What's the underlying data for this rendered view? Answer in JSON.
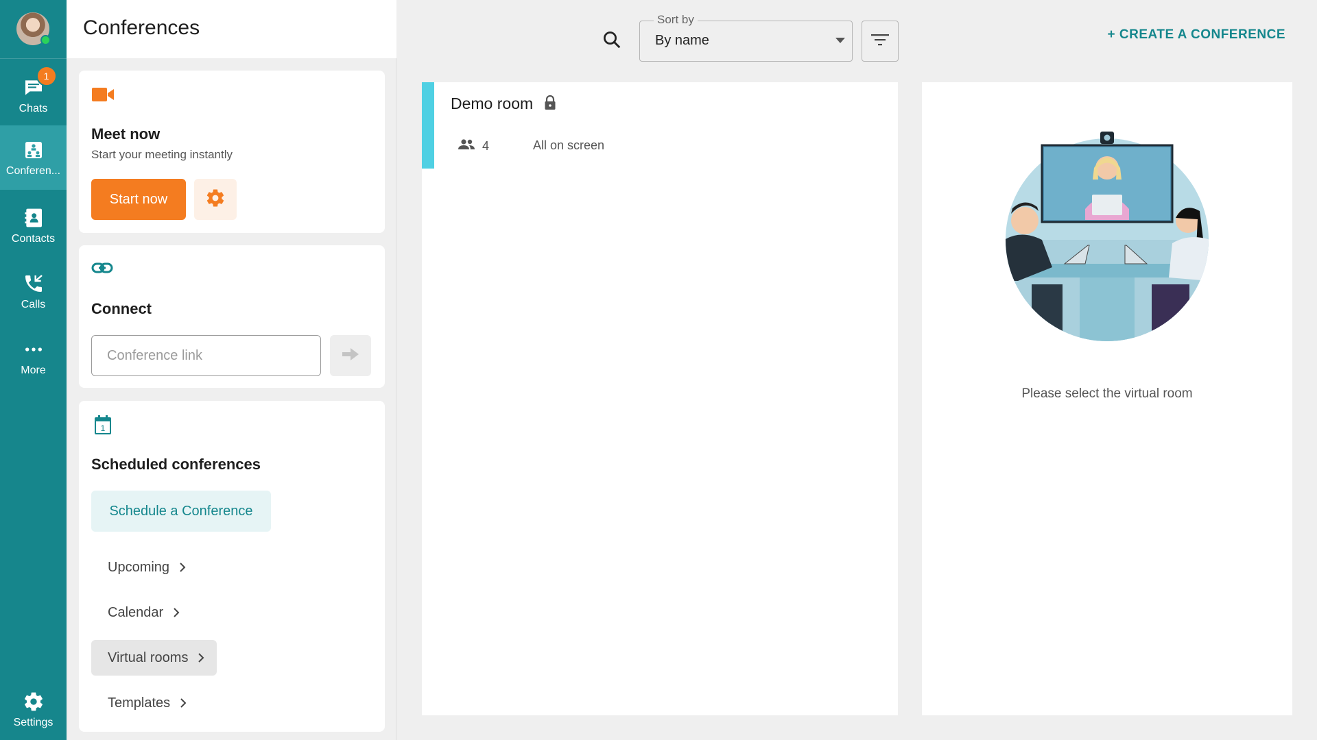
{
  "nav": {
    "items": [
      {
        "label": "Chats",
        "badge": "1"
      },
      {
        "label": "Conferen..."
      },
      {
        "label": "Contacts"
      },
      {
        "label": "Calls"
      },
      {
        "label": "More"
      }
    ],
    "settings_label": "Settings",
    "active": "Conferen..."
  },
  "panel": {
    "title": "Conferences",
    "meet_now": {
      "title": "Meet now",
      "subtitle": "Start your meeting instantly",
      "start_label": "Start now"
    },
    "connect": {
      "title": "Connect",
      "link_placeholder": "Conference link"
    },
    "scheduled": {
      "title": "Scheduled conferences",
      "schedule_label": "Schedule a Conference",
      "links": [
        "Upcoming",
        "Calendar",
        "Virtual rooms",
        "Templates"
      ],
      "active_link": "Virtual rooms"
    }
  },
  "toolbar": {
    "sort_label": "Sort by",
    "sort_value": "By name",
    "create_label": "+ CREATE A CONFERENCE"
  },
  "rooms": [
    {
      "name": "Demo room",
      "participants": "4",
      "mode": "All on screen",
      "locked": true
    }
  ],
  "detail": {
    "empty_message": "Please select the virtual room"
  },
  "colors": {
    "rail": "#16868c",
    "accent_orange": "#f47c20",
    "accent_teal": "#15878d",
    "room_accent": "#4fd0e3",
    "presence": "#2bd35a"
  },
  "icons": [
    "chat-icon",
    "conference-icon",
    "contacts-icon",
    "calls-icon",
    "more-icon",
    "settings-icon",
    "video-camera-icon",
    "gear-icon",
    "link-icon",
    "arrow-right-icon",
    "calendar-icon",
    "chevron-right-icon",
    "search-icon",
    "filter-icon",
    "lock-icon",
    "people-icon"
  ]
}
